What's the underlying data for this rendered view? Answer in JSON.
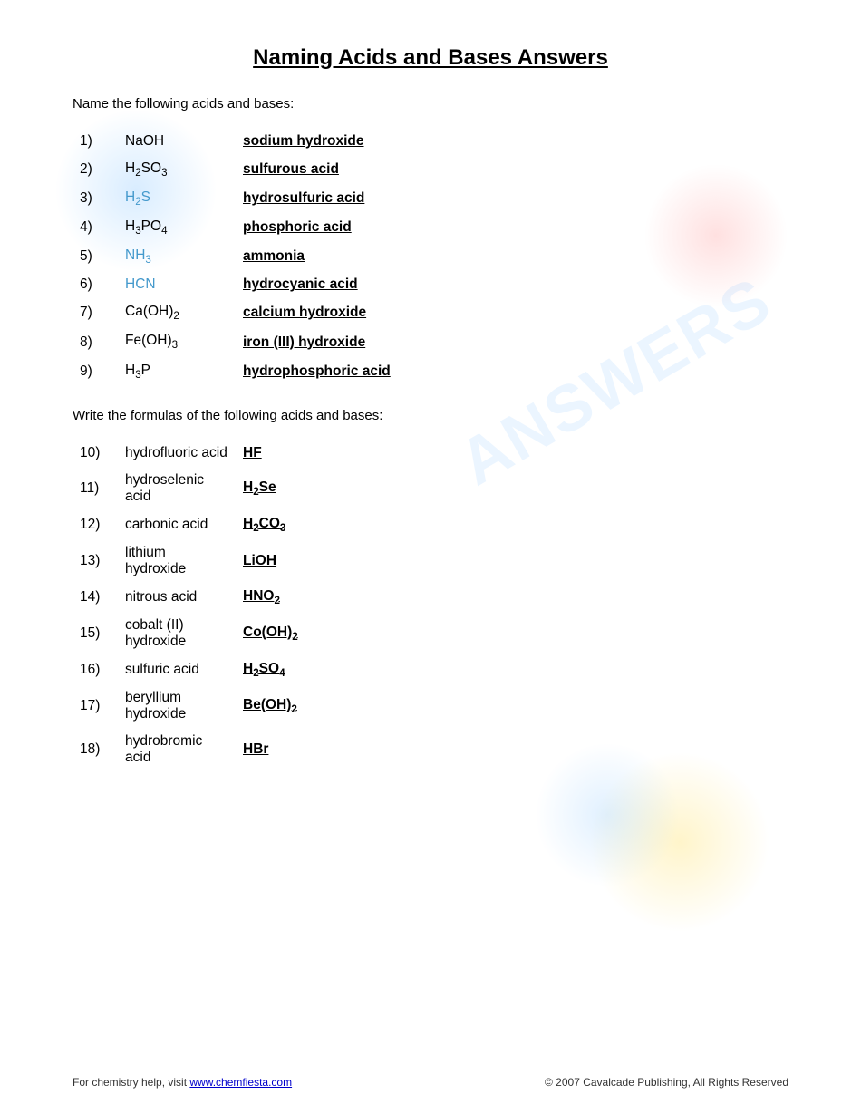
{
  "title": "Naming Acids and Bases Answers",
  "section1_label": "Name the following acids and bases:",
  "section2_label": "Write the formulas of the following acids and bases:",
  "part1": [
    {
      "num": "1)",
      "formula_html": "NaOH",
      "answer": "sodium hydroxide"
    },
    {
      "num": "2)",
      "formula_html": "H<sub>2</sub>SO<sub>3</sub>",
      "answer": "sulfurous acid"
    },
    {
      "num": "3)",
      "formula_html": "H<sub>2</sub>S",
      "answer": "hydrosulfuric acid",
      "formula_class": "h2s"
    },
    {
      "num": "4)",
      "formula_html": "H<sub>3</sub>PO<sub>4</sub>",
      "answer": "phosphoric acid"
    },
    {
      "num": "5)",
      "formula_html": "NH<sub>3</sub>",
      "answer": "ammonia",
      "formula_class": "nh3"
    },
    {
      "num": "6)",
      "formula_html": "HCN",
      "answer": "hydrocyanic acid",
      "formula_class": "hcn"
    },
    {
      "num": "7)",
      "formula_html": "Ca(OH)<sub>2</sub>",
      "answer": "calcium hydroxide"
    },
    {
      "num": "8)",
      "formula_html": "Fe(OH)<sub>3</sub>",
      "answer": "iron (III) hydroxide"
    },
    {
      "num": "9)",
      "formula_html": "H<sub>3</sub>P",
      "answer": "hydrophosphoric acid"
    }
  ],
  "part2": [
    {
      "num": "10)",
      "name": "hydrofluoric acid",
      "answer_html": "HF"
    },
    {
      "num": "11)",
      "name": "hydroselenic acid",
      "answer_html": "H<sub>2</sub>Se"
    },
    {
      "num": "12)",
      "name": "carbonic acid",
      "answer_html": "H<sub>2</sub>CO<sub>3</sub>"
    },
    {
      "num": "13)",
      "name": "lithium hydroxide",
      "answer_html": "LiOH"
    },
    {
      "num": "14)",
      "name": "nitrous acid",
      "answer_html": "HNO<sub>2</sub>"
    },
    {
      "num": "15)",
      "name": "cobalt (II) hydroxide",
      "answer_html": "Co(OH)<sub>2</sub>"
    },
    {
      "num": "16)",
      "name": "sulfuric acid",
      "answer_html": "H<sub>2</sub>SO<sub>4</sub>"
    },
    {
      "num": "17)",
      "name": "beryllium hydroxide",
      "answer_html": "Be(OH)<sub>2</sub>"
    },
    {
      "num": "18)",
      "name": "hydrobromic acid",
      "answer_html": "HBr"
    }
  ],
  "footer": {
    "left_text": "For chemistry help, visit ",
    "link_text": "www.chemfiesta.com",
    "link_url": "http://www.chemfiesta.com",
    "right_text": "© 2007 Cavalcade Publishing, All Rights Reserved"
  }
}
